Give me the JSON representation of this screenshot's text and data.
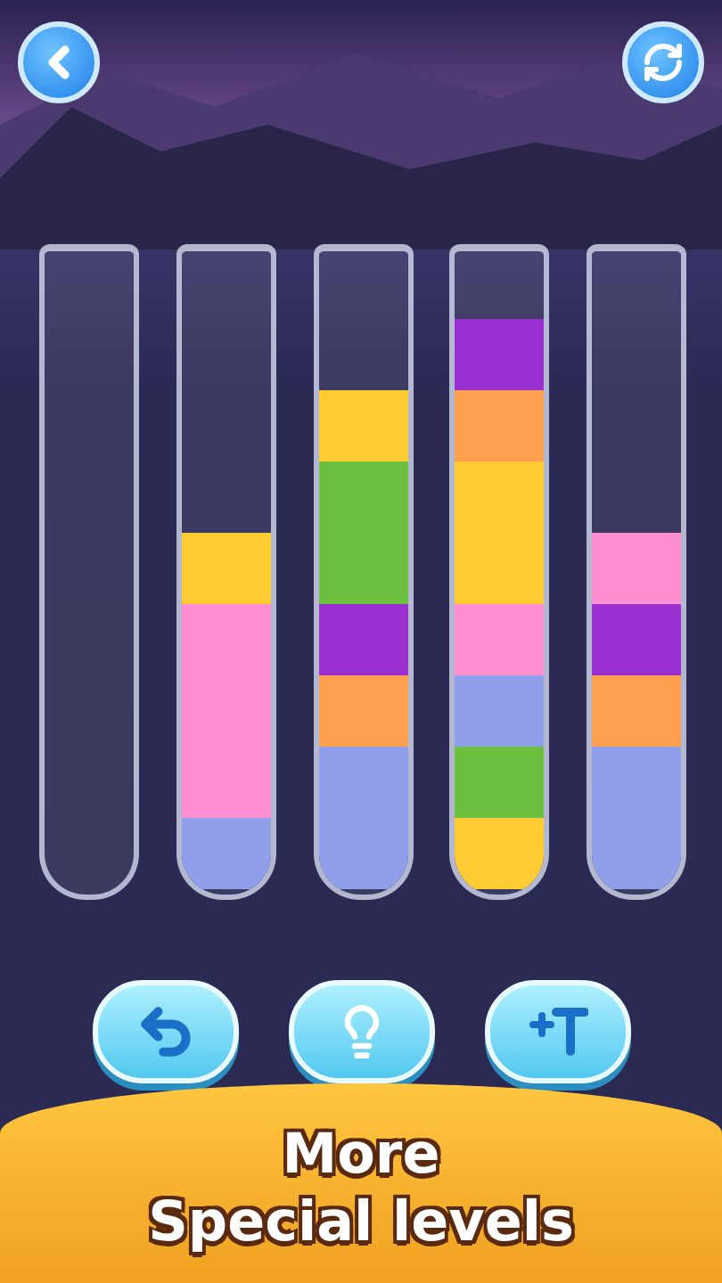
{
  "top_buttons": [
    {
      "kind": "back"
    },
    {
      "kind": "restart"
    }
  ],
  "tubes": [
    {
      "kind": "empty"
    },
    {
      "kind": "filled",
      "layers": [
        {
          "color": "#8f9fea"
        },
        {
          "color": "#ff8fd0"
        },
        {
          "color": "#ff8fd0"
        },
        {
          "color": "#ff8fd0"
        },
        {
          "color": "#ffcc33"
        }
      ]
    },
    {
      "kind": "filled",
      "layers": [
        {
          "color": "#8f9fea"
        },
        {
          "color": "#8f9fea"
        },
        {
          "color": "#ffa050"
        },
        {
          "color": "#9a30d0"
        },
        {
          "color": "#6cc040"
        },
        {
          "color": "#6cc040"
        },
        {
          "color": "#ffcc33"
        }
      ]
    },
    {
      "kind": "filled",
      "layers": [
        {
          "color": "#ffcc33"
        },
        {
          "color": "#6cc040"
        },
        {
          "color": "#8f9fea"
        },
        {
          "color": "#ff8fd0"
        },
        {
          "color": "#ffcc33"
        },
        {
          "color": "#ffcc33"
        },
        {
          "color": "#ffa050"
        },
        {
          "color": "#9a30d0"
        }
      ]
    },
    {
      "kind": "filled",
      "layers": [
        {
          "color": "#8f9fea"
        },
        {
          "color": "#8f9fea"
        },
        {
          "color": "#ffa050"
        },
        {
          "color": "#9a30d0"
        },
        {
          "color": "#ff8fd0"
        }
      ]
    }
  ],
  "tool_buttons": [
    {
      "kind": "undo"
    },
    {
      "kind": "hint"
    },
    {
      "kind": "add_tube"
    }
  ],
  "banner": {
    "lines": [
      "More",
      "Special levels"
    ]
  }
}
